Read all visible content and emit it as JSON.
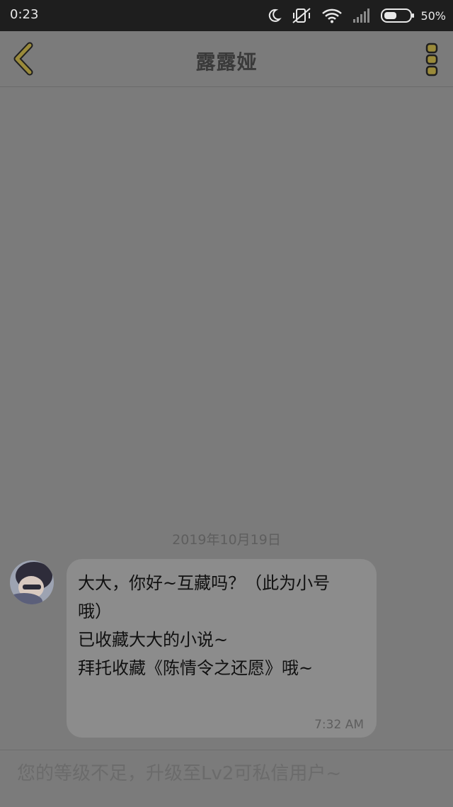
{
  "status_bar": {
    "time": "0:23",
    "battery_percent": "50%",
    "battery_level": 0.5,
    "icons": [
      "moon-icon",
      "vibrate-off-icon",
      "wifi-icon",
      "signal-icon",
      "battery-icon"
    ]
  },
  "header": {
    "title": "露露娅",
    "back_icon": "chevron-left-icon",
    "menu_icon": "vertical-dots-icon",
    "accent_color": "#9a8a3a"
  },
  "chat": {
    "date": "2019年10月19日",
    "messages": [
      {
        "text": "大大，你好~互藏吗？（此为小号哦）\n已收藏大大的小说~\n拜托收藏《陈情令之还愿》哦~",
        "time": "7:32 AM"
      }
    ]
  },
  "input_bar": {
    "notice": "您的等级不足，升级至Lv2可私信用户~"
  }
}
